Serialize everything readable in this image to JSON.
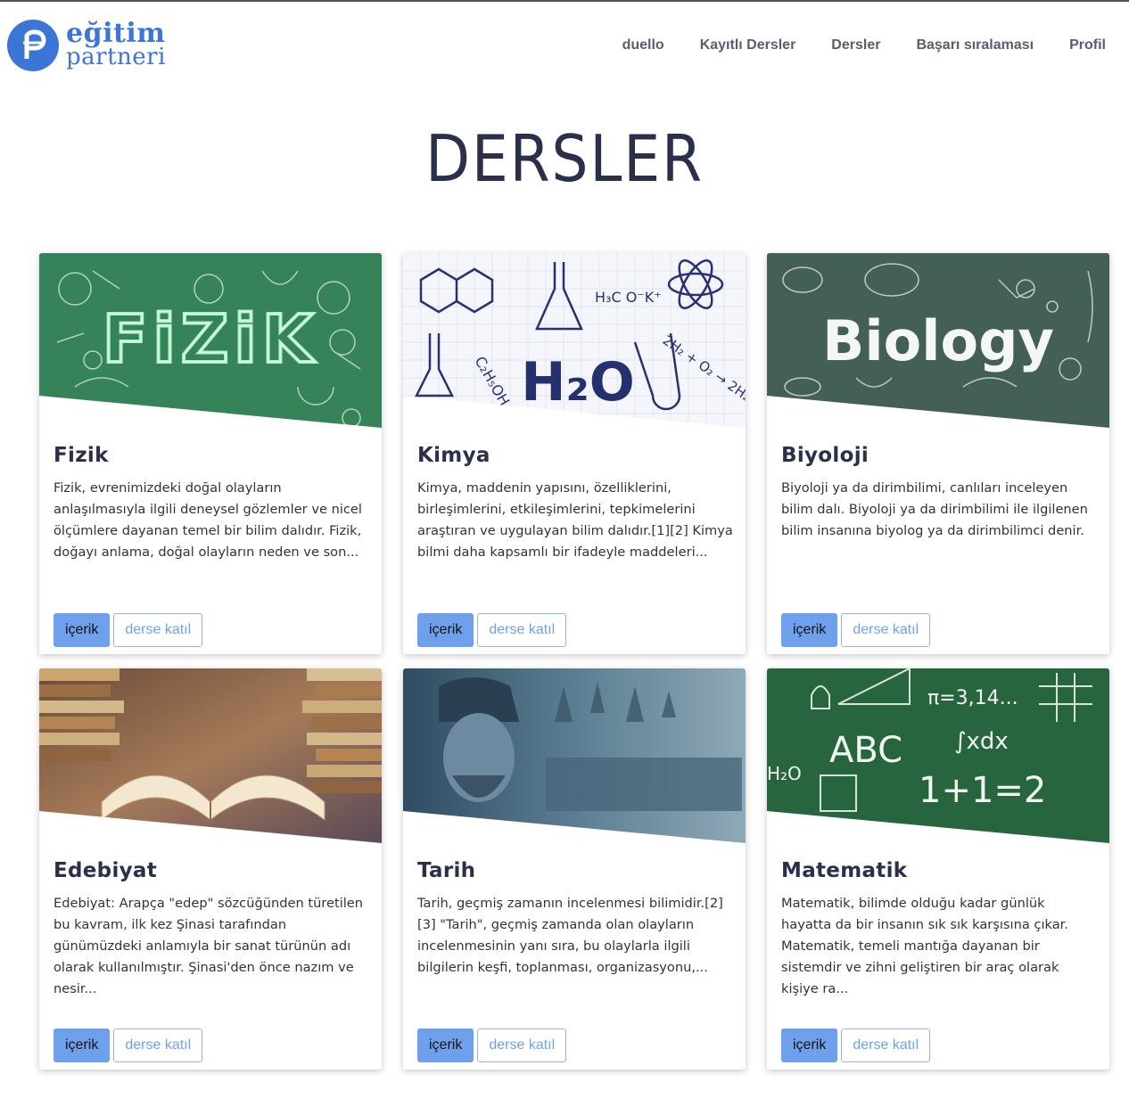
{
  "brand": {
    "line1": "eğitim",
    "line2": "partneri",
    "color": "#3b76d6"
  },
  "nav": [
    {
      "label": "duello"
    },
    {
      "label": "Kayıtlı Dersler"
    },
    {
      "label": "Dersler"
    },
    {
      "label": "Başarı sıralaması"
    },
    {
      "label": "Profil"
    }
  ],
  "page_title": "DERSLER",
  "buttons": {
    "content": "içerik",
    "join": "derse katıl"
  },
  "courses": [
    {
      "title": "Fizik",
      "image_text": "FiZiK",
      "theme": "green-chalkboard",
      "description": "Fizik, evrenimizdeki doğal olayların anlaşılmasıyla ilgili deneysel gözlemler ve nicel ölçümlere dayanan temel bir bilim dalıdır. Fizik, doğayı anlama, doğal olayların neden ve son..."
    },
    {
      "title": "Kimya",
      "image_text": "H₂O",
      "theme": "white-sketch",
      "description": "Kimya, maddenin yapısını, özelliklerini, birleşimlerini, etkileşimlerini, tepkimelerini araştıran ve uygulayan bilim dalıdır.[1][2] Kimya bilmi daha kapsamlı bir ifadeyle maddeleri..."
    },
    {
      "title": "Biyoloji",
      "image_text": "Biology",
      "theme": "grey-chalkboard",
      "description": "Biyoloji ya da dirimbilimi, canlıları inceleyen bilim dalı. Biyoloji ya da dirimbilimi ile ilgilenen bilim insanına biyolog ya da dirimbilimci denir."
    },
    {
      "title": "Edebiyat",
      "image_text": "",
      "theme": "books",
      "description": "Edebiyat: Arapça \"edep\" sözcüğünden türetilen bu kavram, ilk kez Şinasi tarafından günümüzdeki anlamıyla bir sanat türünün adı olarak kullanılmıştır. Şinasi'den önce nazım ve nesir..."
    },
    {
      "title": "Tarih",
      "image_text": "",
      "theme": "history",
      "description": "Tarih, geçmiş zamanın incelenmesi bilimidir.[2][3] \"Tarih\", geçmiş zamanda olan olayların incelenmesinin yanı sıra, bu olaylarla ilgili bilgilerin keşfi, toplanması, organizasyonu,..."
    },
    {
      "title": "Matematik",
      "image_text": "ABC  1+1=2",
      "theme": "green-chalkboard-math",
      "description": "Matematik, bilimde olduğu kadar günlük hayatta da bir insanın sık sık karşısına çıkar. Matematik, temeli mantığa dayanan bir sistemdir ve zihni geliştiren bir araç olarak kişiye ra..."
    }
  ]
}
